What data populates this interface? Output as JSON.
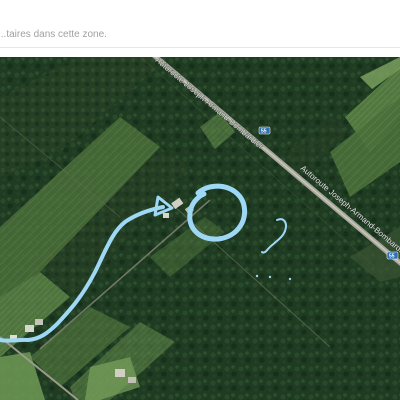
{
  "comment": {
    "placeholder": "...taires dans cette zone."
  },
  "map": {
    "type": "satellite",
    "roads": [
      {
        "name": "Autoroute Joseph-Armand-Bombardier",
        "number": "55"
      }
    ],
    "annotation_color": "#9fd8f5"
  }
}
